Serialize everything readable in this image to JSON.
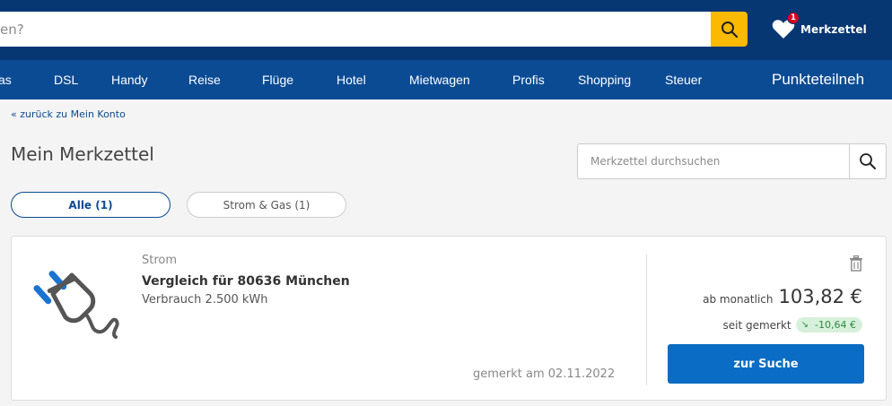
{
  "header": {
    "search_placeholder": "en?",
    "merkzettel_label": "Merkzettel",
    "merkzettel_count": "1"
  },
  "nav": {
    "items": [
      "as",
      "DSL",
      "Handy",
      "Reise",
      "Flüge",
      "Hotel",
      "Mietwagen",
      "Profis",
      "Shopping",
      "Steuer"
    ],
    "right_label": "Punkteteilneh"
  },
  "content": {
    "back_link": "« zurück zu Mein Konto",
    "title": "Mein Merkzettel",
    "search_placeholder": "Merkzettel durchsuchen",
    "tabs": [
      {
        "label": "Alle (1)",
        "active": true
      },
      {
        "label": "Strom & Gas (1)",
        "active": false
      }
    ]
  },
  "card": {
    "category": "Strom",
    "title": "Vergleich für 80636 München",
    "usage": "Verbrauch 2.500 kWh",
    "saved_date": "gemerkt am 02.11.2022",
    "price_prefix": "ab monatlich",
    "price": "103,82 €",
    "since_label": "seit gemerkt",
    "delta": "-10,64 €",
    "cta": "zur Suche"
  },
  "colors": {
    "topbar": "#063773",
    "navbar": "#0a4b94",
    "accent": "#fbb900",
    "cta": "#0a6cc4",
    "badge_red": "#d6001c",
    "delta_bg": "#d7f0dc",
    "delta_fg": "#2f8a3c"
  }
}
